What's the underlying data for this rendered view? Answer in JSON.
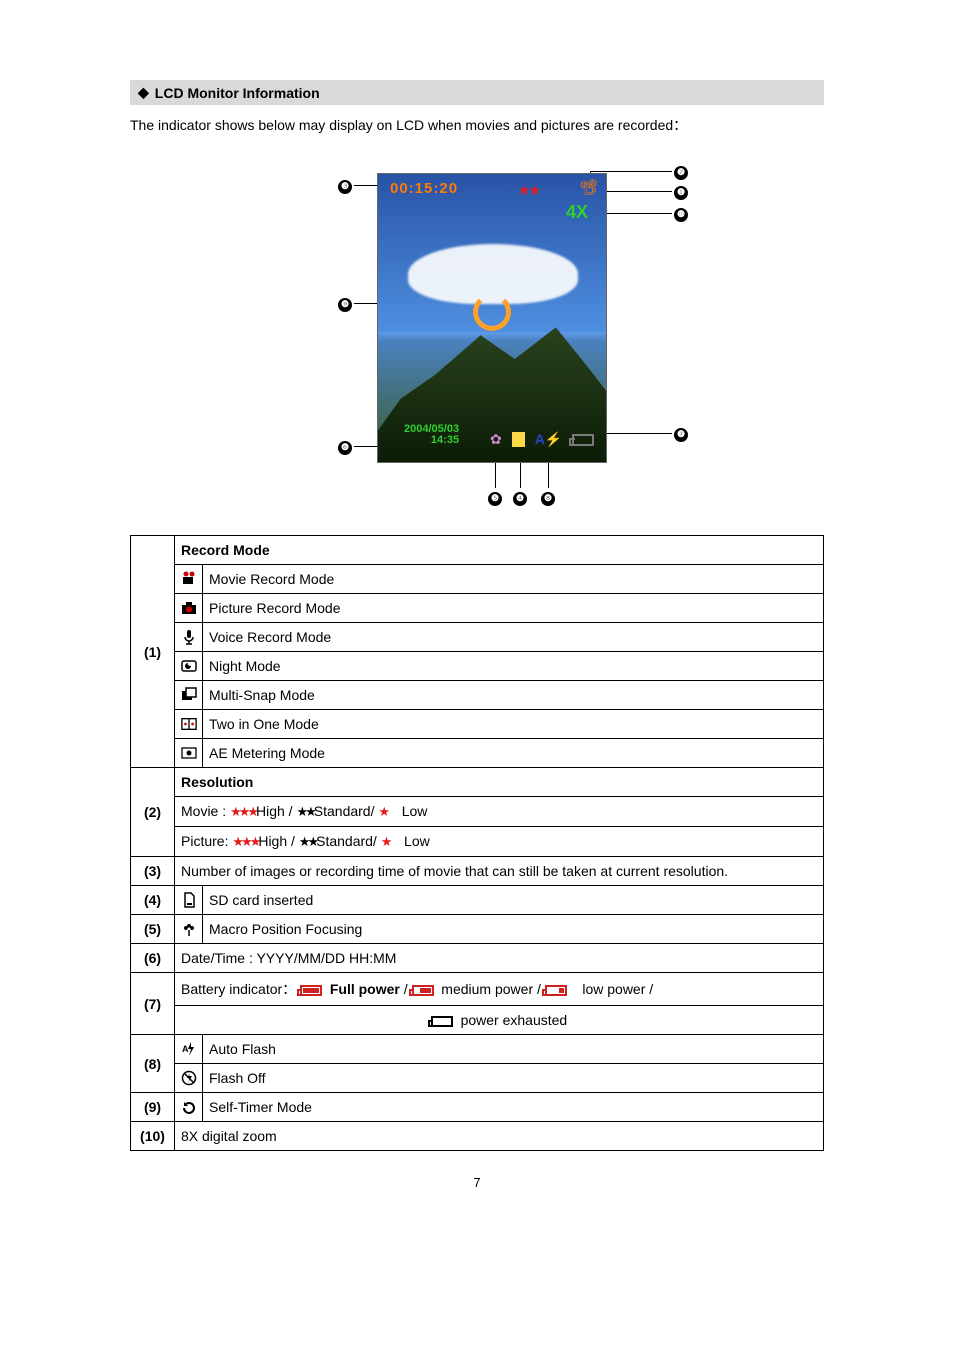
{
  "header": {
    "diamond": "◆",
    "title": "LCD Monitor Information"
  },
  "intro": "The indicator shows below may display on LCD when movies and pictures are recorded：",
  "lcd": {
    "time": "00:15:20",
    "zoom": "4X",
    "date_line1": "2004/05/03",
    "date_line2": "14:35",
    "flash_label": "A"
  },
  "callouts": [
    "❶",
    "❷",
    "❸",
    "❹",
    "❺",
    "❻",
    "❼",
    "❽",
    "❾",
    "❿"
  ],
  "table": {
    "row1": {
      "num": "(1)",
      "header": "Record Mode",
      "items": [
        "Movie Record Mode",
        "Picture Record Mode",
        "Voice Record Mode",
        "Night Mode",
        "Multi-Snap Mode",
        "Two in One Mode",
        "AE Metering Mode"
      ]
    },
    "row2": {
      "num": "(2)",
      "header": "Resolution",
      "movie_prefix": "Movie :",
      "picture_prefix": "Picture:",
      "high": "High /",
      "standard": "Standard/",
      "low": "Low"
    },
    "row3": {
      "num": "(3)",
      "text": "Number of images or recording time of movie that can still be taken at current resolution."
    },
    "row4": {
      "num": "(4)",
      "text": "SD card inserted"
    },
    "row5": {
      "num": "(5)",
      "text": "Macro Position Focusing"
    },
    "row6": {
      "num": "(6)",
      "text": "Date/Time : YYYY/MM/DD HH:MM"
    },
    "row7": {
      "num": "(7)",
      "prefix": "Battery indicator：",
      "full": "Full power",
      "sep": " / ",
      "medium": "medium power / ",
      "low": "low power /",
      "exhausted": "power exhausted"
    },
    "row8": {
      "num": "(8)",
      "items": [
        "Auto Flash",
        "Flash Off"
      ]
    },
    "row9": {
      "num": "(9)",
      "text": "Self-Timer Mode"
    },
    "row10": {
      "num": "(10)",
      "text": "8X digital zoom"
    }
  },
  "page_number": "7"
}
